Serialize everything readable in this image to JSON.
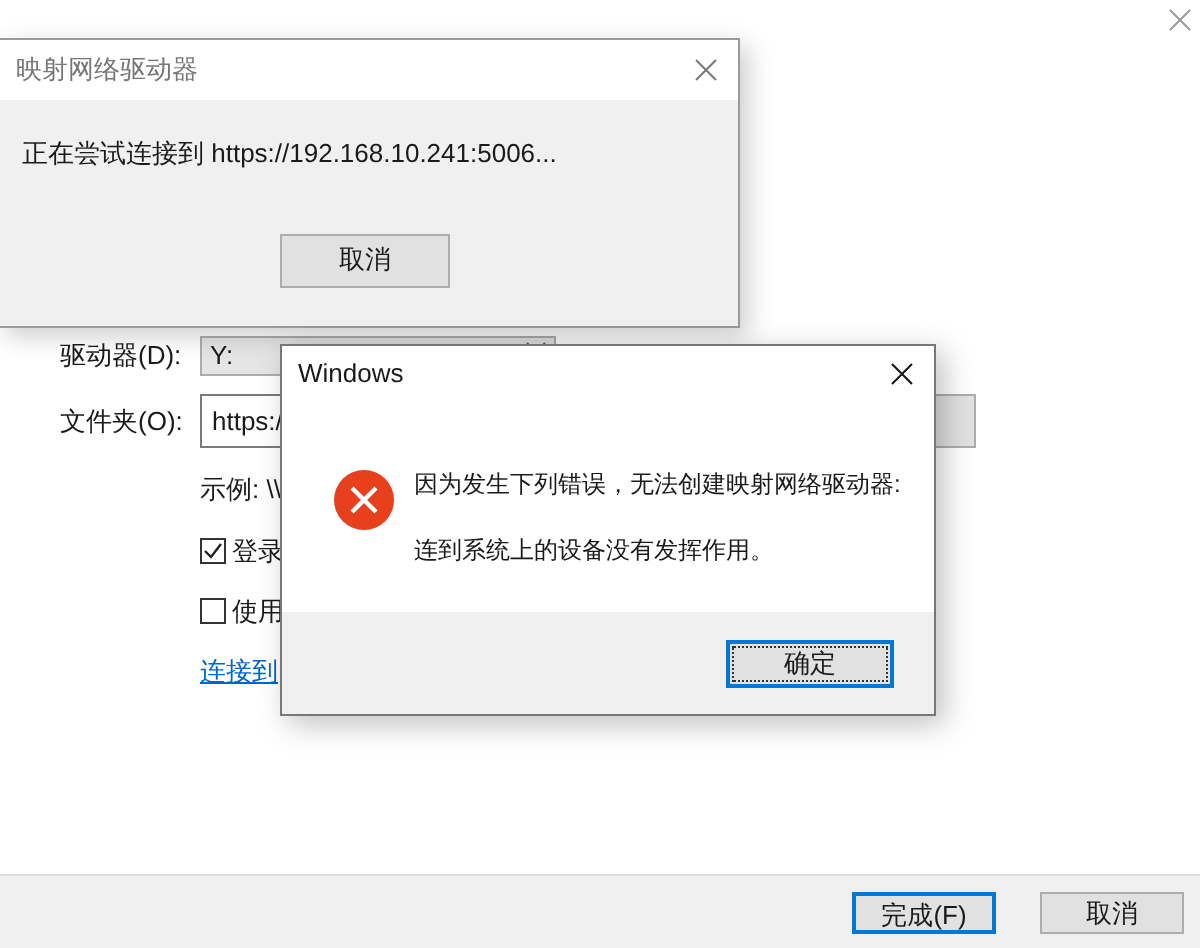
{
  "wizard": {
    "fields": [
      {
        "kind": "dropdown",
        "label": "驱动器(D):",
        "value": "Y:"
      },
      {
        "kind": "text",
        "label": "文件夹(O):",
        "value": "https:/"
      }
    ],
    "example": "示例: \\\\",
    "options": [
      {
        "label": "登录",
        "checked": true
      },
      {
        "label": "使用",
        "checked": false
      }
    ],
    "link": "连接到",
    "buttons": [
      {
        "label": "完成(F)",
        "default": true
      },
      {
        "label": "取消",
        "default": false
      }
    ]
  },
  "progress_dialog": {
    "title": "映射网络驱动器",
    "message": "正在尝试连接到 https://192.168.10.241:5006...",
    "button": "取消"
  },
  "error_dialog": {
    "title": "Windows",
    "lines": [
      "因为发生下列错误，无法创建映射网络驱动器:",
      "连到系统上的设备没有发挥作用。"
    ],
    "button": "确定"
  }
}
